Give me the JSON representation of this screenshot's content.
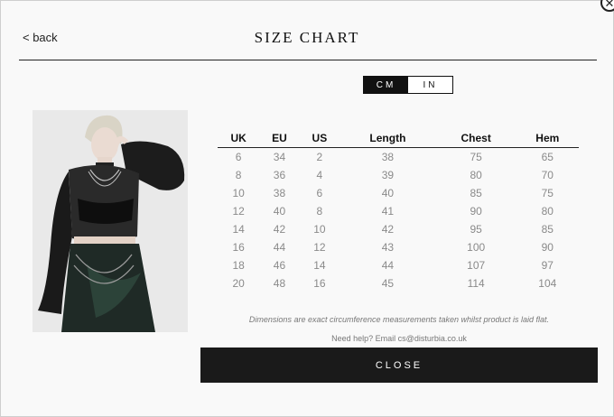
{
  "modal": {
    "back_label": "< back",
    "title": "SIZE CHART",
    "close_icon": "close-icon"
  },
  "unit_toggle": {
    "options": [
      "CM",
      "IN"
    ],
    "selected": "CM"
  },
  "table": {
    "headers": [
      "UK",
      "EU",
      "US",
      "Length",
      "Chest",
      "Hem"
    ],
    "rows": [
      [
        "6",
        "34",
        "2",
        "38",
        "75",
        "65"
      ],
      [
        "8",
        "36",
        "4",
        "39",
        "80",
        "70"
      ],
      [
        "10",
        "38",
        "6",
        "40",
        "85",
        "75"
      ],
      [
        "12",
        "40",
        "8",
        "41",
        "90",
        "80"
      ],
      [
        "14",
        "42",
        "10",
        "42",
        "95",
        "85"
      ],
      [
        "16",
        "44",
        "12",
        "43",
        "100",
        "90"
      ],
      [
        "18",
        "46",
        "14",
        "44",
        "107",
        "97"
      ],
      [
        "20",
        "48",
        "16",
        "45",
        "114",
        "104"
      ]
    ]
  },
  "note": "Dimensions are exact circumference measurements taken whilst product is laid flat.",
  "help": "Need help? Email cs@disturbia.co.uk",
  "close_button_label": "CLOSE",
  "colors": {
    "accent": "#1a1a1a",
    "background": "#f9f9f9",
    "muted_text": "#8a8a8a"
  }
}
